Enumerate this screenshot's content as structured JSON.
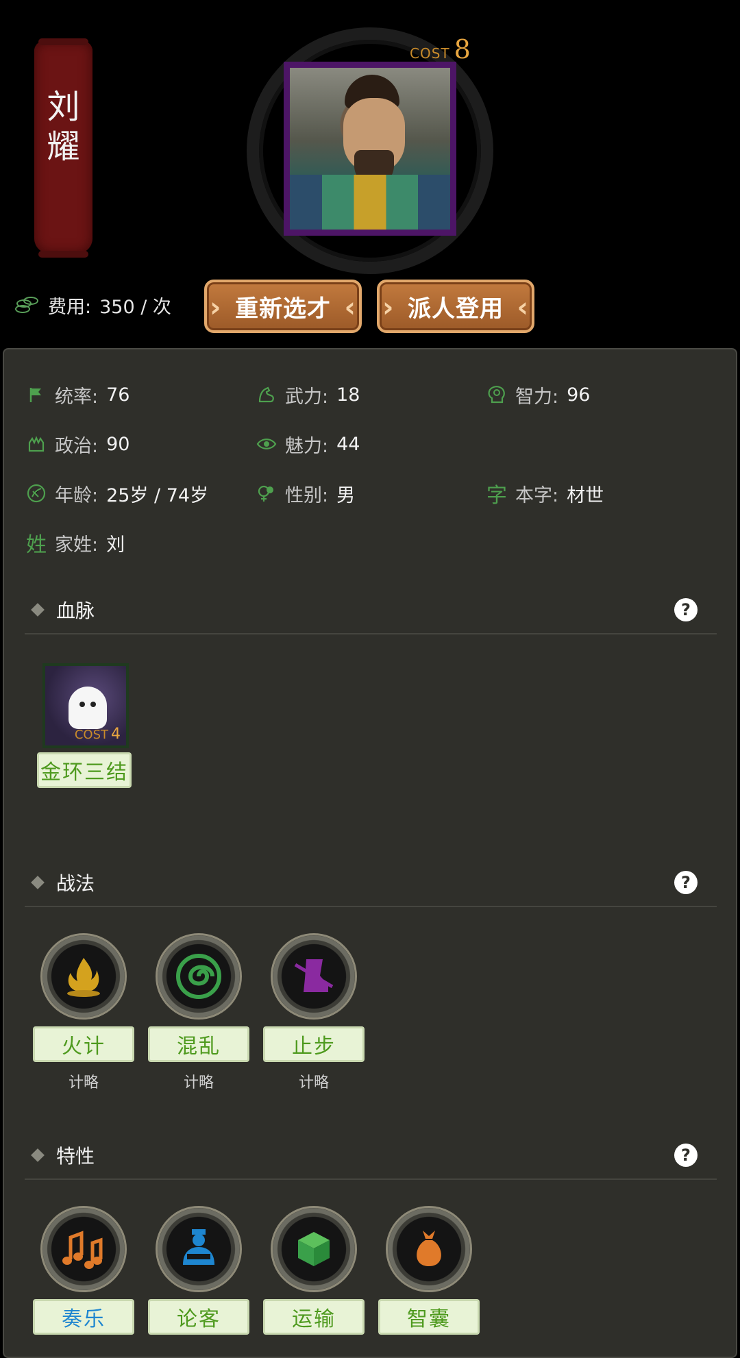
{
  "header": {
    "name_chars": [
      "刘",
      "耀"
    ],
    "cost_word": "COST",
    "cost_value": "8",
    "fee_label": "费用:",
    "fee_value": "350 / 次",
    "reselect_button": "重新选才",
    "dispatch_button": "派人登用"
  },
  "stats": [
    [
      {
        "icon": "flag-icon",
        "label": "统率:",
        "value": "76"
      },
      {
        "icon": "arm-icon",
        "label": "武力:",
        "value": "18"
      },
      {
        "icon": "brain-icon",
        "label": "智力:",
        "value": "96"
      }
    ],
    [
      {
        "icon": "politics-icon",
        "label": "政治:",
        "value": "90"
      },
      {
        "icon": "eye-icon",
        "label": "魅力:",
        "value": "44"
      }
    ],
    [
      {
        "icon": "age-icon",
        "label": "年龄:",
        "value": "25岁 / 74岁"
      },
      {
        "icon": "gender-icon",
        "label": "性别:",
        "value": "男"
      },
      {
        "icon": "zi-char-icon",
        "glyph": "字",
        "label": "本字:",
        "value": "材世"
      }
    ],
    [
      {
        "icon": "surname-char-icon",
        "glyph": "姓",
        "label": "家姓:",
        "value": "刘"
      }
    ]
  ],
  "bloodline": {
    "title": "血脉",
    "help": "?",
    "item": {
      "name": "金环三结",
      "cost_word": "COST",
      "cost_value": "4",
      "icon": "ghost-icon"
    }
  },
  "tactics": {
    "title": "战法",
    "help": "?",
    "items": [
      {
        "name": "火计",
        "kind": "计略",
        "icon": "fire-icon",
        "color": "#d4a21e"
      },
      {
        "name": "混乱",
        "kind": "计略",
        "icon": "swirl-icon",
        "color": "#3aa04a"
      },
      {
        "name": "止步",
        "kind": "计略",
        "icon": "boot-icon",
        "color": "#8a2aa0"
      }
    ]
  },
  "traits": {
    "title": "特性",
    "help": "?",
    "items": [
      {
        "name": "奏乐",
        "icon": "music-notes-icon",
        "color": "#e07a2a",
        "text_color": "#1e86d0"
      },
      {
        "name": "论客",
        "icon": "debater-icon",
        "color": "#1e86d0",
        "text_color": "#4e9a1e"
      },
      {
        "name": "运输",
        "icon": "box-icon",
        "color": "#3aa04a",
        "text_color": "#4e9a1e"
      },
      {
        "name": "智囊",
        "icon": "pouch-icon",
        "color": "#e07a2a",
        "text_color": "#4e9a1e"
      }
    ]
  }
}
